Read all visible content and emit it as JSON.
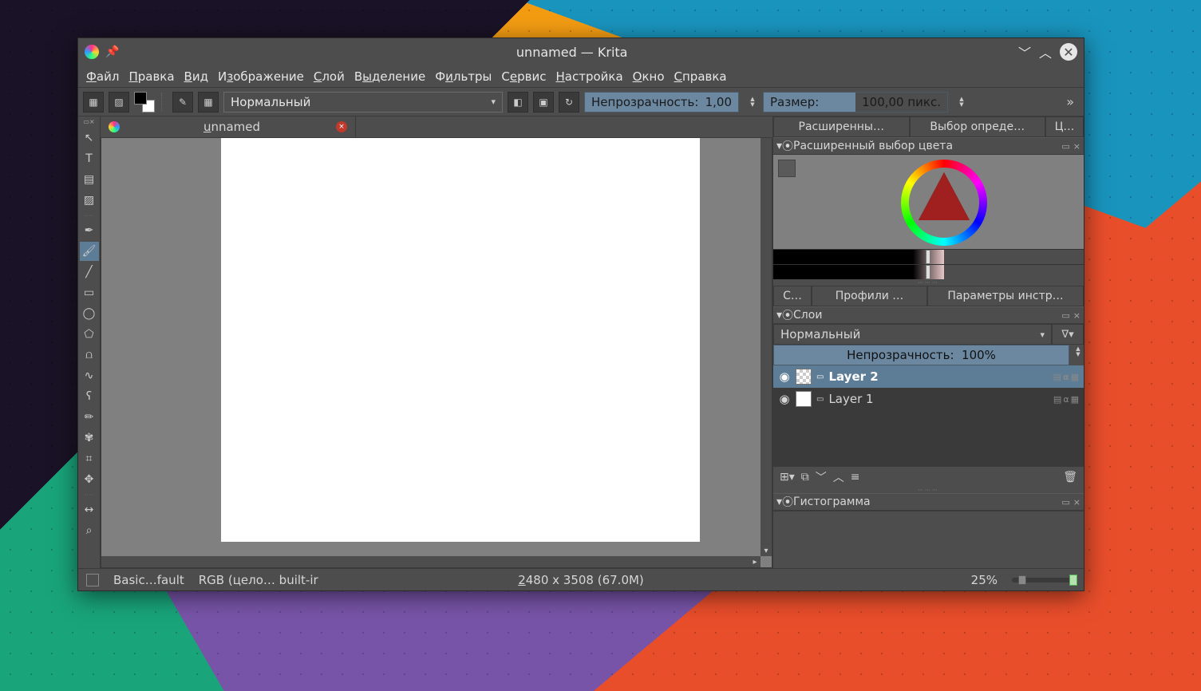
{
  "titlebar": {
    "title": "unnamed  — Krita"
  },
  "menu": {
    "file": "Файл",
    "edit": "Правка",
    "view": "Вид",
    "image": "Изображение",
    "layer": "Слой",
    "select": "Выделение",
    "filters": "Фильтры",
    "tools": "Сервис",
    "settings": "Настройка",
    "window": "Окно",
    "help": "Справка"
  },
  "toolbar": {
    "blend_mode": "Нормальный",
    "opacity_label": "Непрозрачность:",
    "opacity_value": "1,00",
    "size_label": "Размер:",
    "size_value": "100,00 пикс."
  },
  "doc_tab": {
    "name": "unnamed"
  },
  "right": {
    "tabs": {
      "advanced": "Расширенны…",
      "specific": "Выбор опреде…",
      "c": "Ц…"
    },
    "color_header": "Расширенный выбор цвета",
    "mid_tabs": {
      "s": "С…",
      "profiles": "Профили …",
      "tool_opts": "Параметры инстр…"
    },
    "layers_header": "Слои",
    "layer_blend": "Нормальный",
    "layer_opacity_label": "Непрозрачность:",
    "layer_opacity_value": "100%",
    "layers": [
      {
        "name": "Layer 2",
        "active": true,
        "checker": true
      },
      {
        "name": "Layer 1",
        "active": false,
        "checker": false
      }
    ],
    "histogram_header": "Гистограмма"
  },
  "statusbar": {
    "brush": "Basic…fault",
    "colorspace": "RGB (цело… built-ir",
    "dimensions": "2480 x 3508 (67.0M)",
    "zoom": "25%"
  }
}
